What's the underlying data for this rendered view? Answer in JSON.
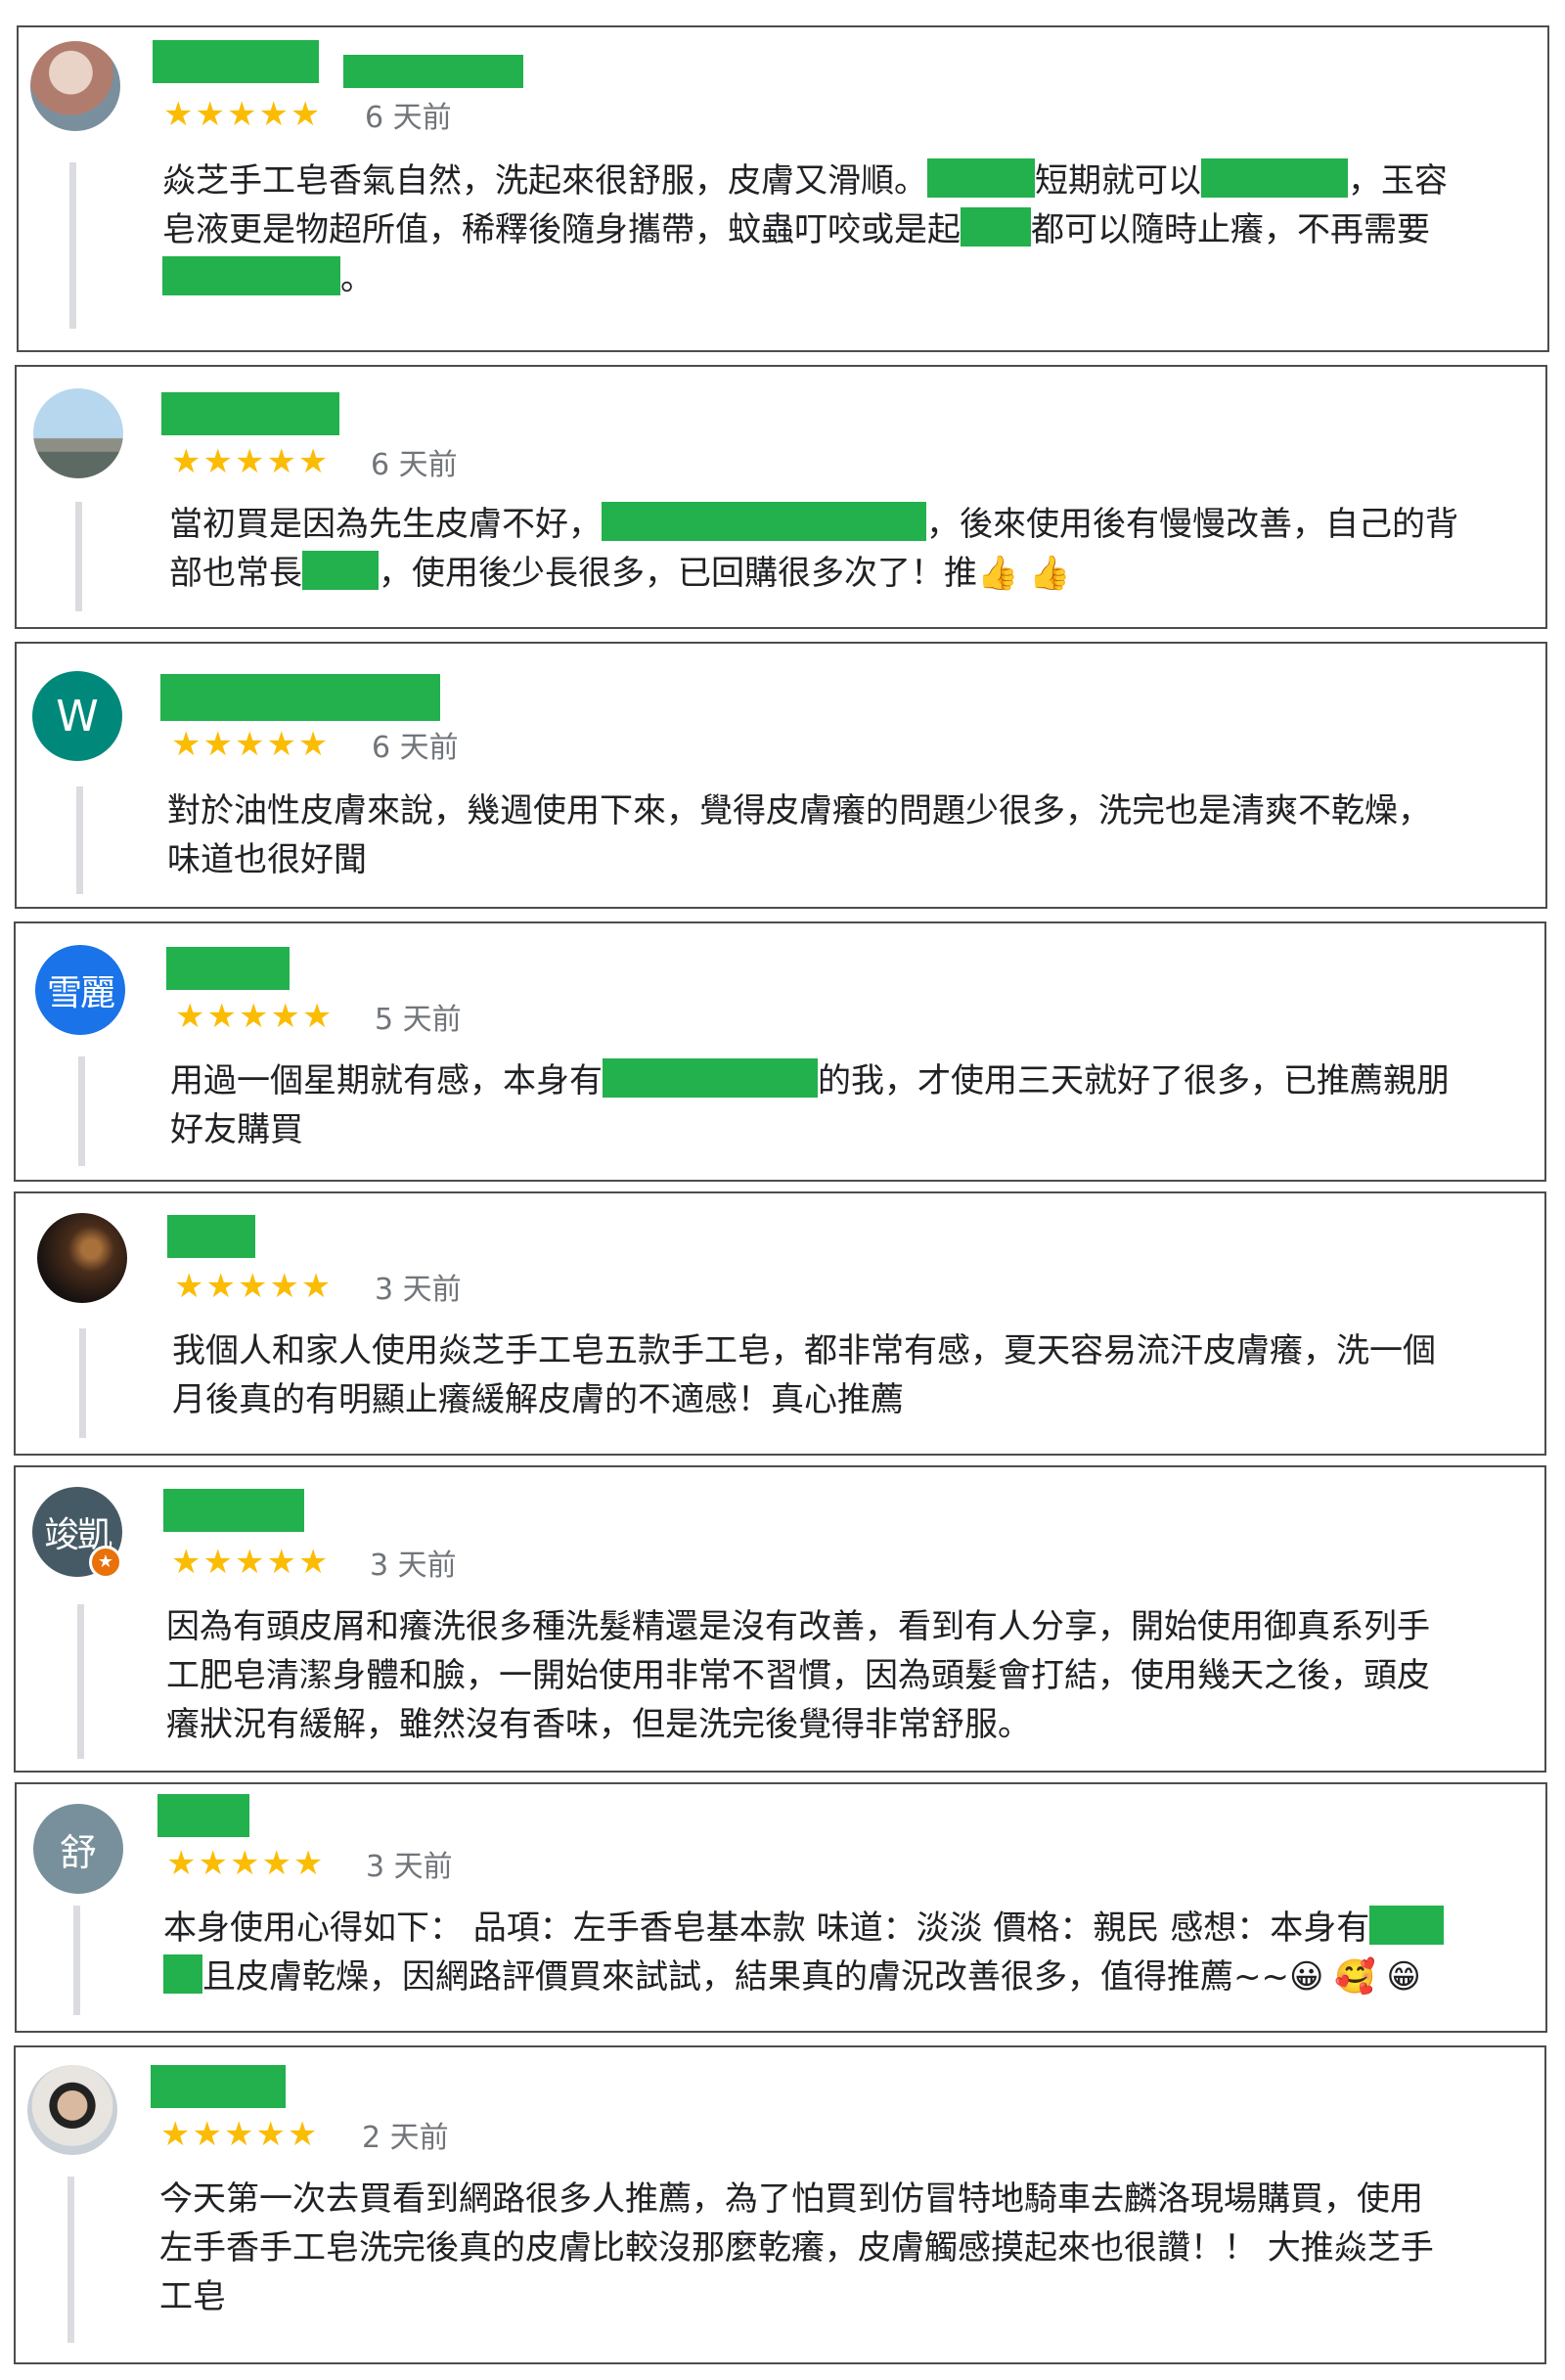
{
  "reviews": [
    {
      "avatar_type": "photo",
      "avatar_colors": [
        "#d9c3b4",
        "#a46f63"
      ],
      "stars": "★★★★★",
      "date": "6 天前",
      "lines": [
        [
          "焱芝手工皂香氣自然，洗起來很舒服，皮膚又滑順。",
          "",
          "短期就可以",
          "",
          "，玉容"
        ],
        [
          "皂液更是物超所值，稀釋後隨身攜帶，蚊蟲叮咬或是起",
          "",
          "都可以隨時止癢，不再需要"
        ],
        [
          "",
          "。"
        ]
      ]
    },
    {
      "avatar_type": "photo",
      "avatar_colors": [
        "#9ec6e6",
        "#6f7b76"
      ],
      "stars": "★★★★★",
      "date": "6 天前",
      "lines": [
        [
          "當初買是因為先生皮膚不好，",
          "",
          "，後來使用後有慢慢改善，自己的背"
        ],
        [
          "部也常長",
          "",
          "，使用後少長很多，已回購很多次了！推👍 👍"
        ]
      ]
    },
    {
      "avatar_type": "letter",
      "avatar_text": "W",
      "avatar_color": "#00897b",
      "stars": "★★★★★",
      "date": "6 天前",
      "lines": [
        [
          "對於油性皮膚來說，幾週使用下來，覺得皮膚癢的問題少很多，洗完也是清爽不乾燥，"
        ],
        [
          "味道也很好聞"
        ]
      ]
    },
    {
      "avatar_type": "letter",
      "avatar_text": "雪麗",
      "avatar_color": "#1a73e8",
      "stars": "★★★★★",
      "date": "5 天前",
      "lines": [
        [
          "用過一個星期就有感，本身有",
          "",
          "的我，才使用三天就好了很多，已推薦親朋"
        ],
        [
          "好友購買"
        ]
      ]
    },
    {
      "avatar_type": "photo",
      "avatar_colors": [
        "#6b3f21",
        "#1e140f"
      ],
      "stars": "★★★★★",
      "date": "3 天前",
      "lines": [
        [
          "我個人和家人使用焱芝手工皂五款手工皂，都非常有感，夏天容易流汗皮膚癢，洗一個"
        ],
        [
          "月後真的有明顯止癢緩解皮膚的不適感！真心推薦"
        ]
      ]
    },
    {
      "avatar_type": "letter",
      "avatar_text": "竣凱",
      "avatar_color": "#455a64",
      "badge": "★",
      "stars": "★★★★★",
      "date": "3 天前",
      "lines": [
        [
          "因為有頭皮屑和癢洗很多種洗髮精還是沒有改善，看到有人分享，開始使用御真系列手"
        ],
        [
          "工肥皂清潔身體和臉，一開始使用非常不習慣，因為頭髮會打結，使用幾天之後，頭皮"
        ],
        [
          "癢狀況有緩解，雖然沒有香味，但是洗完後覺得非常舒服。"
        ]
      ]
    },
    {
      "avatar_type": "letter",
      "avatar_text": "舒",
      "avatar_color": "#78909c",
      "stars": "★★★★★",
      "date": "3 天前",
      "lines": [
        [
          "本身使用心得如下： 品項：左手香皂基本款 味道：淡淡 價格：親民 感想：本身有",
          ""
        ],
        [
          "",
          "且皮膚乾燥，因網路評價買來試試，結果真的膚況改善很多，值得推薦~~😀 🥰 😁"
        ]
      ]
    },
    {
      "avatar_type": "photo",
      "avatar_colors": [
        "#e8e4e0",
        "#222222"
      ],
      "stars": "★★★★★",
      "date": "2 天前",
      "lines": [
        [
          "今天第一次去買看到網路很多人推薦，為了怕買到仿冒特地騎車去麟洛現場購買，使用"
        ],
        [
          "左手香手工皂洗完後真的皮膚比較沒那麼乾癢，皮膚觸感摸起來也很讚！！ 大推焱芝手"
        ],
        [
          "工皂"
        ]
      ]
    }
  ]
}
